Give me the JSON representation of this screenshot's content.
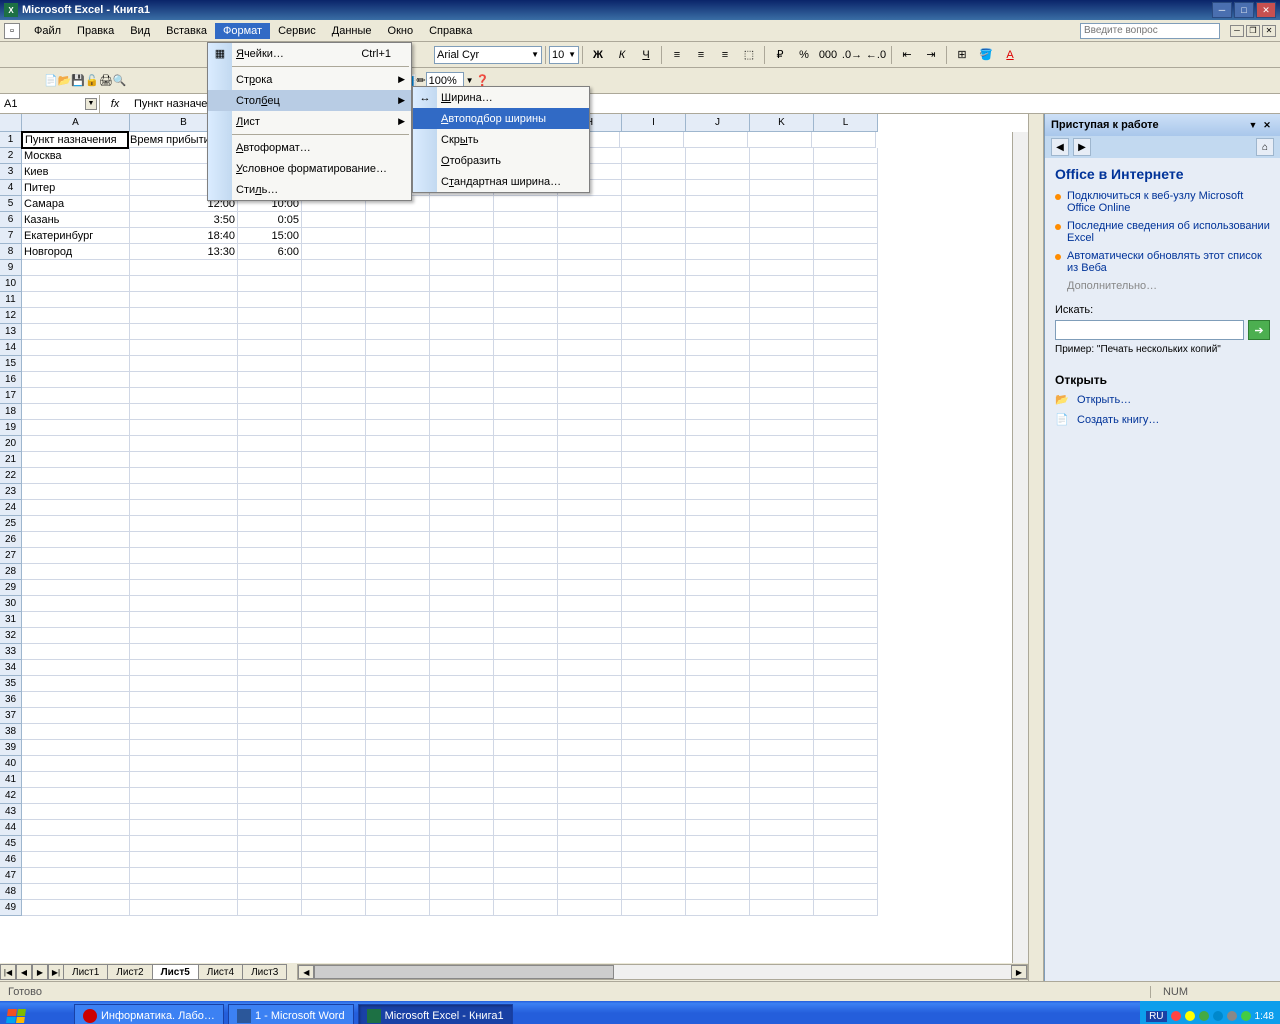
{
  "window": {
    "title": "Microsoft Excel - Книга1"
  },
  "menubar": {
    "items": [
      "Файл",
      "Правка",
      "Вид",
      "Вставка",
      "Формат",
      "Сервис",
      "Данные",
      "Окно",
      "Справка"
    ],
    "help_placeholder": "Введите вопрос"
  },
  "formatting": {
    "font_name": "Arial Cyr",
    "font_size": "10",
    "zoom": "100%"
  },
  "namebox": {
    "ref": "A1",
    "fx": "fx",
    "formula": "Пункт назначения"
  },
  "format_menu": {
    "cells": "Ячейки…",
    "cells_shortcut": "Ctrl+1",
    "row": "Строка",
    "column": "Столбец",
    "sheet": "Лист",
    "autoformat": "Автоформат…",
    "conditional": "Условное форматирование…",
    "style": "Стиль…"
  },
  "column_submenu": {
    "width": "Ширина…",
    "autofit": "Автоподбор ширины",
    "hide": "Скрыть",
    "unhide": "Отобразить",
    "standard": "Стандартная ширина…"
  },
  "columns": [
    "A",
    "B",
    "C",
    "D",
    "E",
    "F",
    "G",
    "H",
    "I",
    "J",
    "K",
    "L"
  ],
  "grid": [
    {
      "A": "Пункт назначения",
      "B": "Время прибытия",
      "C": ""
    },
    {
      "A": "Москва",
      "B": "",
      "C": ""
    },
    {
      "A": "Киев",
      "B": "",
      "C": ""
    },
    {
      "A": "Питер",
      "B": "",
      "C": ""
    },
    {
      "A": "Самара",
      "B": "12:00",
      "C": "10:00"
    },
    {
      "A": "Казань",
      "B": "3:50",
      "C": "0:05"
    },
    {
      "A": "Екатеринбург",
      "B": "18:40",
      "C": "15:00"
    },
    {
      "A": "Новгород",
      "B": "13:30",
      "C": "6:00"
    }
  ],
  "sheet_tabs": [
    "Лист1",
    "Лист2",
    "Лист5",
    "Лист4",
    "Лист3"
  ],
  "active_sheet": "Лист5",
  "taskpane": {
    "title": "Приступая к работе",
    "section1_title": "Office в Интернете",
    "links": [
      "Подключиться к веб-узлу Microsoft Office Online",
      "Последние сведения об использовании Excel",
      "Автоматически обновлять этот список из Веба"
    ],
    "more": "Дополнительно…",
    "search_label": "Искать:",
    "example": "Пример: \"Печать нескольких копий\"",
    "open_title": "Открыть",
    "open_link": "Открыть…",
    "create_link": "Создать книгу…"
  },
  "statusbar": {
    "ready": "Готово",
    "num": "NUM"
  },
  "taskbar": {
    "tasks": [
      "Информатика. Лабо…",
      "1 - Microsoft Word",
      "Microsoft Excel - Книга1"
    ],
    "lang": "RU",
    "time": "1:48"
  }
}
